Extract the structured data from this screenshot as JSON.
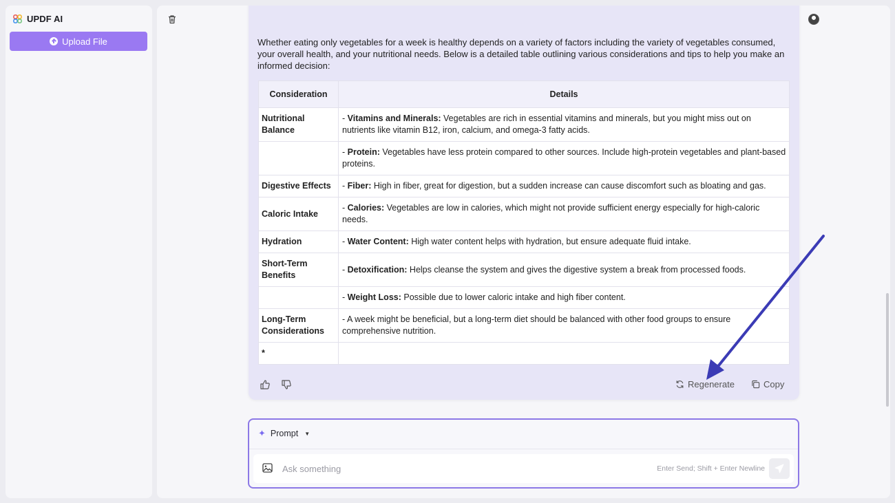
{
  "sidebar": {
    "app_name": "UPDF AI",
    "upload_label": "Upload File"
  },
  "answer": {
    "intro": "Whether eating only vegetables for a week is healthy depends on a variety of factors including the variety of vegetables consumed, your overall health, and your nutritional needs. Below is a detailed table outlining various considerations and tips to help you make an informed decision:",
    "table": {
      "headers": [
        "Consideration",
        "Details"
      ],
      "rows": [
        {
          "consideration": "Nutritional Balance",
          "prefix": "- ",
          "bold": "Vitamins and Minerals:",
          "text": " Vegetables are rich in essential vitamins and minerals, but you might miss out on nutrients like vitamin B12, iron, calcium, and omega-3 fatty acids."
        },
        {
          "consideration": "",
          "prefix": "- ",
          "bold": "Protein:",
          "text": " Vegetables have less protein compared to other sources. Include high-protein vegetables and plant-based proteins."
        },
        {
          "consideration": "Digestive Effects",
          "prefix": "- ",
          "bold": "Fiber:",
          "text": " High in fiber, great for digestion, but a sudden increase can cause discomfort such as bloating and gas."
        },
        {
          "consideration": "Caloric Intake",
          "prefix": "- ",
          "bold": "Calories:",
          "text": " Vegetables are low in calories, which might not provide sufficient energy especially for high-caloric needs."
        },
        {
          "consideration": "Hydration",
          "prefix": "- ",
          "bold": "Water Content:",
          "text": " High water content helps with hydration, but ensure adequate fluid intake."
        },
        {
          "consideration": "Short-Term Benefits",
          "prefix": "- ",
          "bold": "Detoxification:",
          "text": " Helps cleanse the system and gives the digestive system a break from processed foods."
        },
        {
          "consideration": "",
          "prefix": "- ",
          "bold": "Weight Loss:",
          "text": " Possible due to lower caloric intake and high fiber content."
        },
        {
          "consideration": "Long-Term Considerations",
          "prefix": "- ",
          "bold": "",
          "text": "A week might be beneficial, but a long-term diet should be balanced with other food groups to ensure comprehensive nutrition."
        },
        {
          "consideration": "*",
          "prefix": "",
          "bold": "",
          "text": ""
        }
      ]
    },
    "regenerate_label": "Regenerate",
    "copy_label": "Copy"
  },
  "prompt": {
    "mode_label": "Prompt",
    "placeholder": "Ask something",
    "hint": "Enter Send; Shift + Enter Newline"
  },
  "colors": {
    "accent": "#9a79f2",
    "annotation_arrow": "#3b3bb5"
  }
}
